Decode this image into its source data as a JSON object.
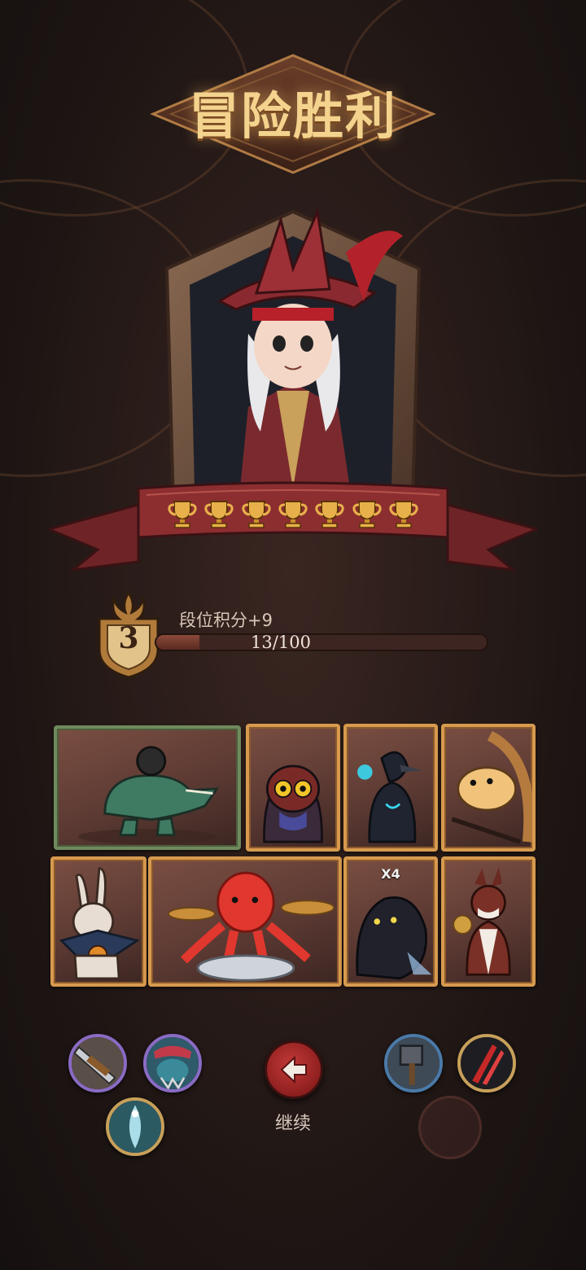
{
  "screen": {
    "title": "冒险胜利"
  },
  "hero": {
    "character": "pirate-captain",
    "trophy_count": 7
  },
  "rank": {
    "level": "3",
    "points_label": "段位积分+9",
    "progress_text": "13/100",
    "progress_fraction": 0.13
  },
  "team": {
    "cards": [
      {
        "name": "crocodile-bomber",
        "count": "",
        "selected": true
      },
      {
        "name": "owl",
        "count": ""
      },
      {
        "name": "raven-mage",
        "count": ""
      },
      {
        "name": "hamster-wheel",
        "count": ""
      },
      {
        "name": "rabbit-scarecrow",
        "count": ""
      },
      {
        "name": "octopus-drummer",
        "count": ""
      },
      {
        "name": "black-panther",
        "count": "X4"
      },
      {
        "name": "weasel-cymbal",
        "count": ""
      }
    ]
  },
  "skills": {
    "left": [
      "blade-skill-icon",
      "spiked-beast-skill-icon",
      "whirlwind-skill-icon"
    ],
    "right": [
      "hammer-skill-icon",
      "claw-slash-skill-icon"
    ]
  },
  "actions": {
    "continue_label": "继续"
  },
  "colors": {
    "title_gold": "#f3d38d",
    "card_border": "#d79a4e",
    "selected_border": "#6f8a5c",
    "continue_red": "#c23a36"
  }
}
